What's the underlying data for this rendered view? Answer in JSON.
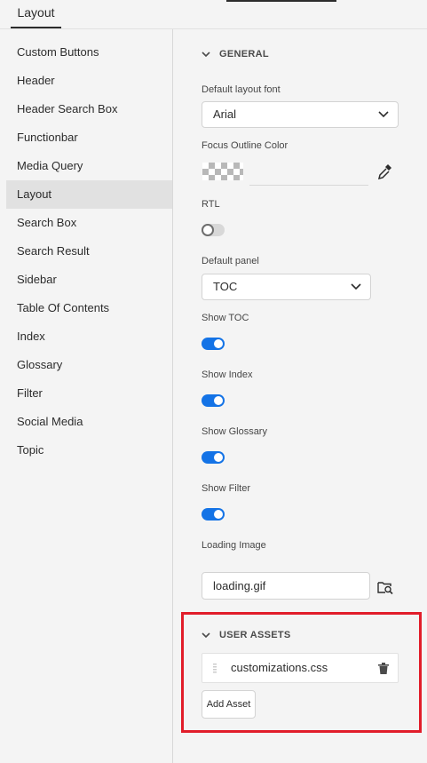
{
  "tabs": {
    "active_label": "Layout"
  },
  "sidebar": {
    "items": [
      {
        "label": "Custom Buttons"
      },
      {
        "label": "Header"
      },
      {
        "label": "Header Search Box"
      },
      {
        "label": "Functionbar"
      },
      {
        "label": "Media Query"
      },
      {
        "label": "Layout",
        "active": true
      },
      {
        "label": "Search Box"
      },
      {
        "label": "Search Result"
      },
      {
        "label": "Sidebar"
      },
      {
        "label": "Table Of Contents"
      },
      {
        "label": "Index"
      },
      {
        "label": "Glossary"
      },
      {
        "label": "Filter"
      },
      {
        "label": "Social Media"
      },
      {
        "label": "Topic"
      }
    ]
  },
  "general": {
    "title": "GENERAL",
    "default_font_label": "Default layout font",
    "default_font_value": "Arial",
    "focus_color_label": "Focus Outline Color",
    "rtl_label": "RTL",
    "rtl_on": false,
    "default_panel_label": "Default panel",
    "default_panel_value": "TOC",
    "show_toc_label": "Show TOC",
    "show_toc_on": true,
    "show_index_label": "Show Index",
    "show_index_on": true,
    "show_glossary_label": "Show Glossary",
    "show_glossary_on": true,
    "show_filter_label": "Show Filter",
    "show_filter_on": true,
    "loading_image_label": "Loading Image",
    "loading_image_value": "loading.gif"
  },
  "user_assets": {
    "title": "USER ASSETS",
    "items": [
      {
        "name": "customizations.css"
      }
    ],
    "add_label": "Add Asset"
  },
  "colors": {
    "accent": "#1473e6",
    "highlight_border": "#e11d2a",
    "panel_bg": "#f4f4f4",
    "active_item_bg": "#e1e1e1"
  }
}
